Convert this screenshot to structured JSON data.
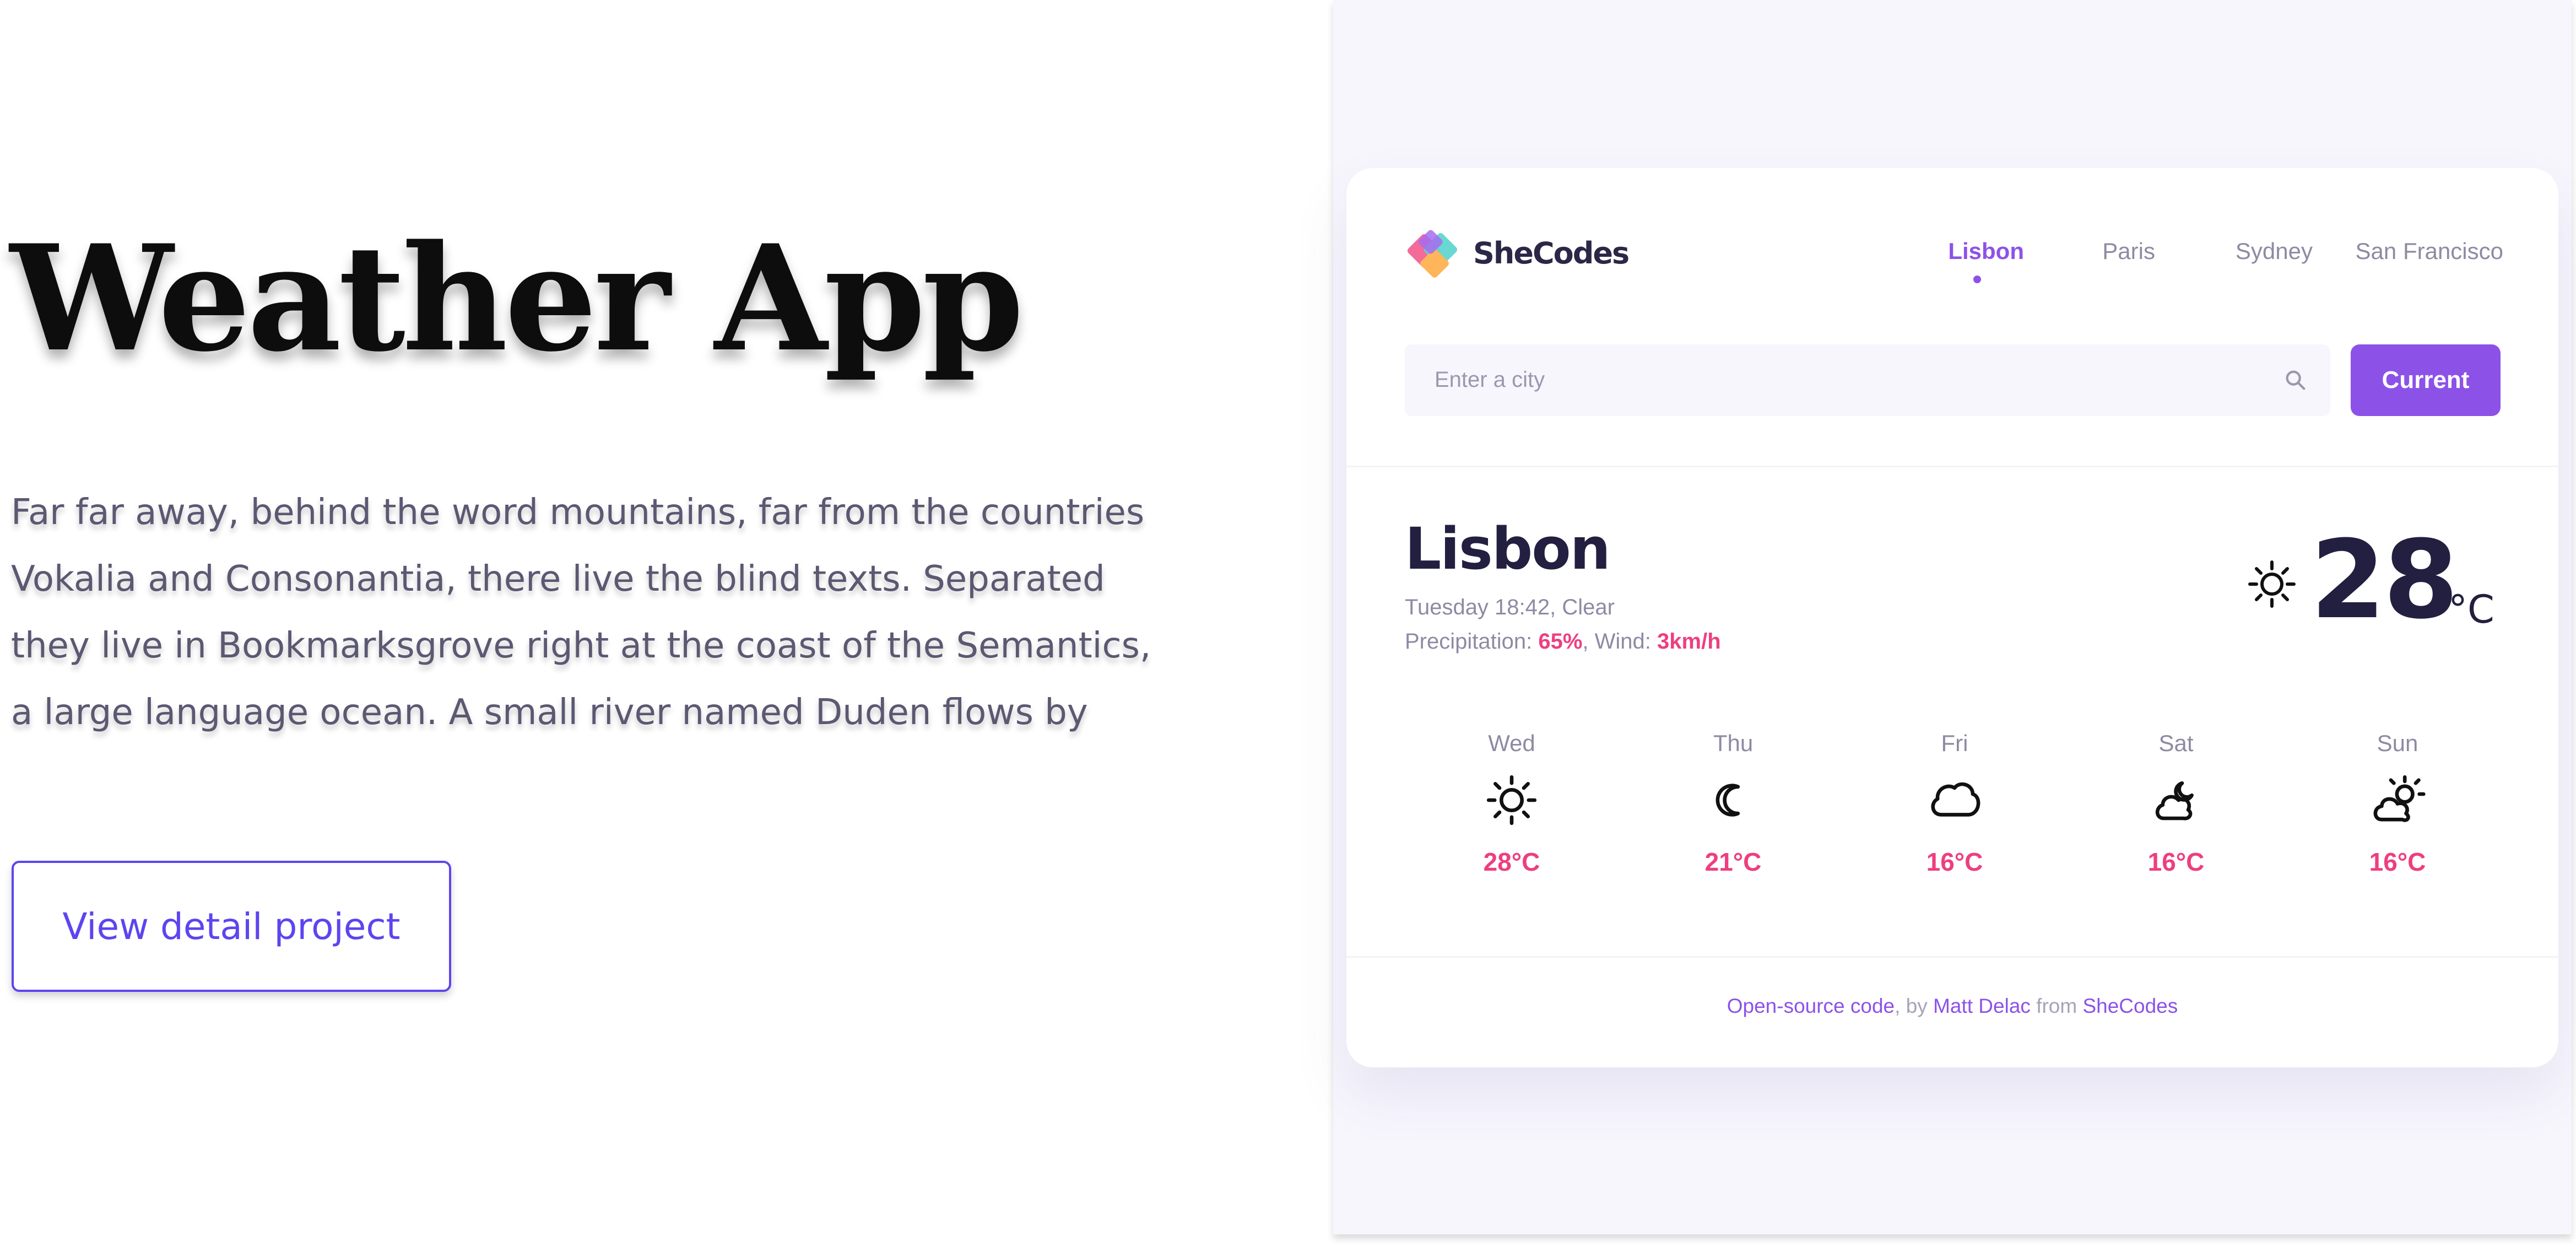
{
  "hero": {
    "title": "Weather App",
    "description_lines": [
      "Far far away, behind the word mountains, far from the countries",
      "Vokalia and Consonantia, there live the blind texts. Separated",
      "they live in Bookmarksgrove right at the coast of the Semantics,",
      "a large language ocean. A small river named Duden flows by"
    ],
    "button_label": "View detail project"
  },
  "app": {
    "brand": "SheCodes",
    "nav": [
      {
        "label": "Lisbon",
        "active": true
      },
      {
        "label": "Paris",
        "active": false
      },
      {
        "label": "Sydney",
        "active": false
      },
      {
        "label": "San Francisco",
        "active": false
      }
    ],
    "search": {
      "placeholder": "Enter a city"
    },
    "current_label": "Current",
    "weather": {
      "city": "Lisbon",
      "datetime": "Tuesday 18:42, Clear",
      "precipitation_label": "Precipitation:",
      "precipitation": "65%",
      "wind_label": "Wind:",
      "wind": "3km/h",
      "temperature": "28",
      "unit": "°C",
      "icon": "sun-icon"
    },
    "forecast": [
      {
        "day": "Wed",
        "temp": "28°C",
        "icon": "sun-icon"
      },
      {
        "day": "Thu",
        "temp": "21°C",
        "icon": "moon-icon"
      },
      {
        "day": "Fri",
        "temp": "16°C",
        "icon": "cloud-icon"
      },
      {
        "day": "Sat",
        "temp": "16°C",
        "icon": "night-cloud-icon"
      },
      {
        "day": "Sun",
        "temp": "16°C",
        "icon": "partly-cloudy-icon"
      }
    ],
    "footer": {
      "source_link": "Open-source code",
      "by_text": ", by",
      "author_link": "Matt Delac",
      "from_text": "from",
      "org_link": "SheCodes"
    }
  },
  "colors": {
    "accent": "#8c52e8",
    "hot": "#ee3e80",
    "cta": "#5c45f0"
  }
}
